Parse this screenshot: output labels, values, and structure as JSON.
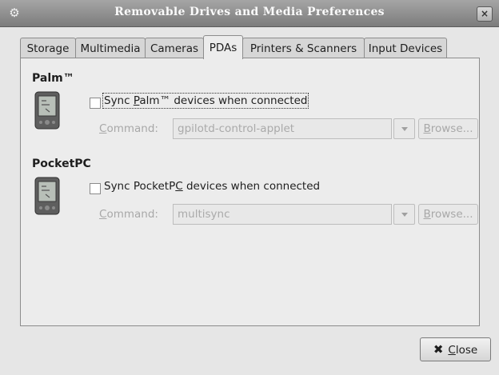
{
  "window": {
    "title": "Removable Drives and Media Preferences",
    "menu_icon": "gear-menu-icon",
    "close_icon": "close-icon",
    "close_glyph": "×"
  },
  "tabs": [
    {
      "label": "Storage",
      "active": false
    },
    {
      "label": "Multimedia",
      "active": false
    },
    {
      "label": "Cameras",
      "active": false
    },
    {
      "label": "PDAs",
      "active": true
    },
    {
      "label": "Printers & Scanners",
      "active": false
    },
    {
      "label": "Input Devices",
      "active": false
    }
  ],
  "palm": {
    "title": "Palm™",
    "icon": "pda-icon",
    "sync_pre": "Sync ",
    "sync_mn": "P",
    "sync_post": "alm™ devices when connected",
    "sync_checked": false,
    "cmd_mn": "C",
    "cmd_rest": "ommand:",
    "command_value": "gpilotd-control-applet",
    "browse_mn": "B",
    "browse_rest": "rowse..."
  },
  "pocketpc": {
    "title": "PocketPC",
    "icon": "pda-icon",
    "sync_pre": "Sync PocketP",
    "sync_mn": "C",
    "sync_post": " devices when connected",
    "sync_checked": false,
    "cmd_mn": "C",
    "cmd_rest": "ommand:",
    "command_value": "multisync",
    "browse_mn": "B",
    "browse_rest": "rowse..."
  },
  "footer": {
    "close_mn": "C",
    "close_rest": "lose",
    "close_icon": "x-icon",
    "close_glyph": "✖"
  },
  "colors": {
    "titlebar": "#8e8e8e",
    "window_bg": "#e6e6e6",
    "disabled_text": "#a8a8a8"
  }
}
